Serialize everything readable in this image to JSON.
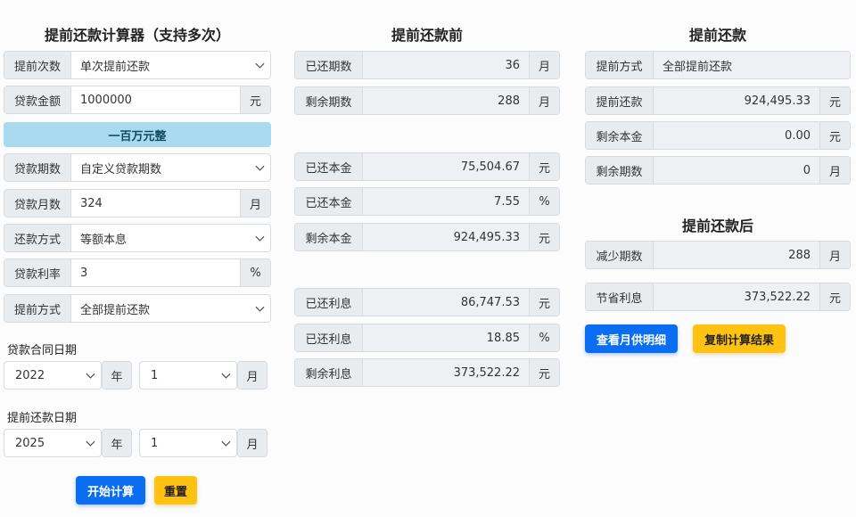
{
  "left": {
    "title": "提前还款计算器（支持多次）",
    "prepay_count": {
      "label": "提前次数",
      "value": "单次提前还款"
    },
    "loan_amount": {
      "label": "贷款金额",
      "value": "1000000",
      "unit": "元"
    },
    "amount_words": "一百万元整",
    "loan_term_type": {
      "label": "贷款期数",
      "value": "自定义贷款期数"
    },
    "loan_months": {
      "label": "贷款月数",
      "value": "324",
      "unit": "月"
    },
    "repay_method": {
      "label": "还款方式",
      "value": "等额本息"
    },
    "rate": {
      "label": "贷款利率",
      "value": "3",
      "unit": "%"
    },
    "prepay_method": {
      "label": "提前方式",
      "value": "全部提前还款"
    },
    "contract_date": {
      "label": "贷款合同日期",
      "year": "2022",
      "year_unit": "年",
      "month": "1",
      "month_unit": "月"
    },
    "prepay_date": {
      "label": "提前还款日期",
      "year": "2025",
      "year_unit": "年",
      "month": "1",
      "month_unit": "月"
    },
    "start_button": "开始计算",
    "reset_button": "重置"
  },
  "middle": {
    "title": "提前还款前",
    "rows": [
      {
        "label": "已还期数",
        "value": "36",
        "unit": "月"
      },
      {
        "label": "剩余期数",
        "value": "288",
        "unit": "月"
      },
      {
        "label": "已还本金",
        "value": "75,504.67",
        "unit": "元"
      },
      {
        "label": "已还本金",
        "value": "7.55",
        "unit": "%"
      },
      {
        "label": "剩余本金",
        "value": "924,495.33",
        "unit": "元"
      },
      {
        "label": "已还利息",
        "value": "86,747.53",
        "unit": "元"
      },
      {
        "label": "已还利息",
        "value": "18.85",
        "unit": "%"
      },
      {
        "label": "剩余利息",
        "value": "373,522.22",
        "unit": "元"
      }
    ]
  },
  "right": {
    "title": "提前还款",
    "method": {
      "label": "提前方式",
      "value": "全部提前还款"
    },
    "rows": [
      {
        "label": "提前还款",
        "value": "924,495.33",
        "unit": "元"
      },
      {
        "label": "剩余本金",
        "value": "0.00",
        "unit": "元"
      },
      {
        "label": "剩余期数",
        "value": "0",
        "unit": "月"
      }
    ],
    "after_title": "提前还款后",
    "after_rows": [
      {
        "label": "减少期数",
        "value": "288",
        "unit": "月"
      },
      {
        "label": "节省利息",
        "value": "373,522.22",
        "unit": "元"
      }
    ],
    "detail_button": "查看月供明细",
    "copy_button": "复制计算结果"
  }
}
